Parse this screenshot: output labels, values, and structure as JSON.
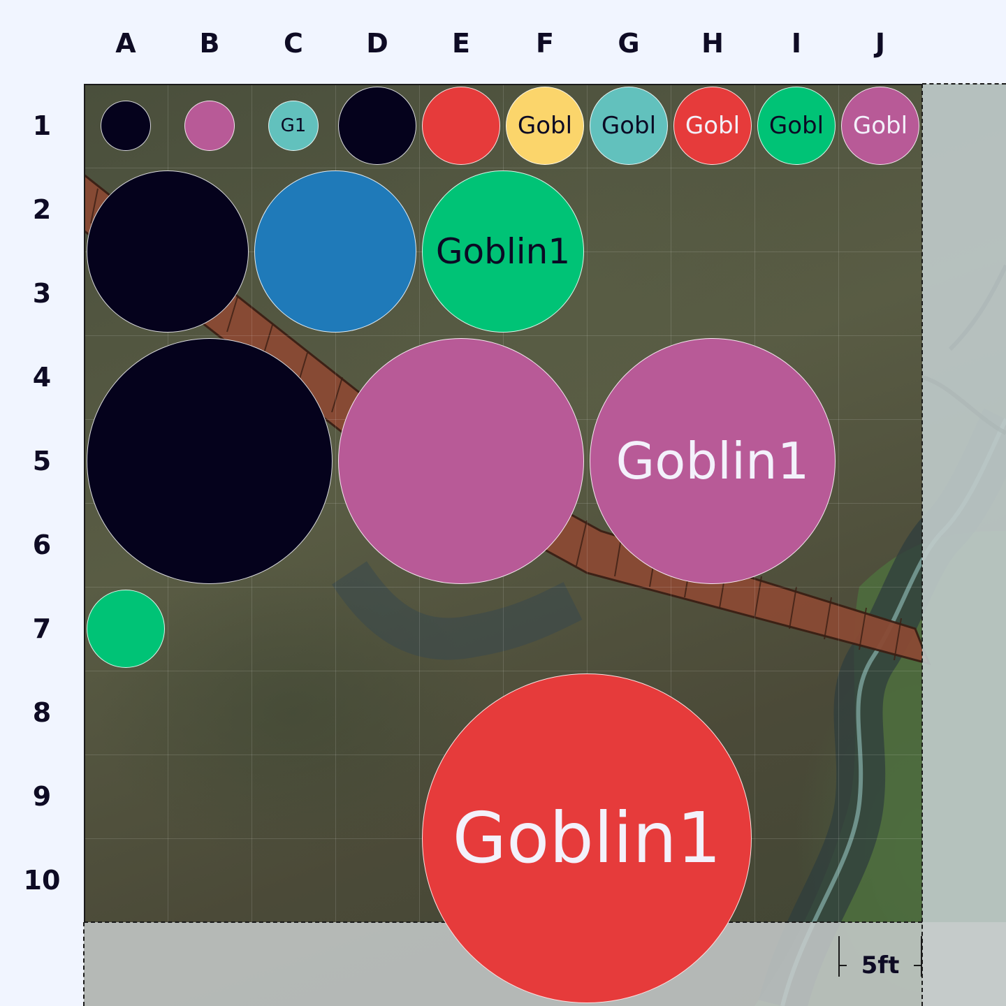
{
  "grid": {
    "columns": [
      "A",
      "B",
      "C",
      "D",
      "E",
      "F",
      "G",
      "H",
      "I",
      "J"
    ],
    "rows": [
      "1",
      "2",
      "3",
      "4",
      "5",
      "6",
      "7",
      "8",
      "9",
      "10"
    ]
  },
  "colors": {
    "navy": "#05021c",
    "pink": "#b85a97",
    "teal": "#62c1bd",
    "red": "#e63b3b",
    "yellow": "#fbd56b",
    "green": "#00c376",
    "blue": "#1f7ab9",
    "dark_text": "#0b0a24",
    "light_text": "#f3f1fb"
  },
  "tokens": [
    {
      "name": "token-a1",
      "col": 1,
      "row": 1,
      "span": 1,
      "scale": 0.6,
      "color": "#05021c",
      "label": "",
      "label_color": "#f3f1fb"
    },
    {
      "name": "token-b1",
      "col": 2,
      "row": 1,
      "span": 1,
      "scale": 0.6,
      "color": "#b85a97",
      "label": "",
      "label_color": "#f3f1fb"
    },
    {
      "name": "token-c1",
      "col": 3,
      "row": 1,
      "span": 1,
      "scale": 0.6,
      "color": "#62c1bd",
      "label": "G1",
      "label_color": "#0b0a24"
    },
    {
      "name": "token-d1",
      "col": 4,
      "row": 1,
      "span": 1,
      "scale": 0.94,
      "color": "#05021c",
      "label": "",
      "label_color": "#f3f1fb"
    },
    {
      "name": "token-e1",
      "col": 5,
      "row": 1,
      "span": 1,
      "scale": 0.94,
      "color": "#e63b3b",
      "label": "",
      "label_color": "#f3f1fb"
    },
    {
      "name": "token-f1",
      "col": 6,
      "row": 1,
      "span": 1,
      "scale": 0.94,
      "color": "#fbd56b",
      "label": "Gobl",
      "label_color": "#0b0a24"
    },
    {
      "name": "token-g1",
      "col": 7,
      "row": 1,
      "span": 1,
      "scale": 0.94,
      "color": "#62c1bd",
      "label": "Gobl",
      "label_color": "#0b0a24"
    },
    {
      "name": "token-h1",
      "col": 8,
      "row": 1,
      "span": 1,
      "scale": 0.94,
      "color": "#e63b3b",
      "label": "Gobl",
      "label_color": "#f3f1fb"
    },
    {
      "name": "token-i1",
      "col": 9,
      "row": 1,
      "span": 1,
      "scale": 0.94,
      "color": "#00c376",
      "label": "Gobl",
      "label_color": "#0b0a24"
    },
    {
      "name": "token-j1",
      "col": 10,
      "row": 1,
      "span": 1,
      "scale": 0.94,
      "color": "#b85a97",
      "label": "Gobl",
      "label_color": "#f3f1fb"
    },
    {
      "name": "token-a2",
      "col": 1,
      "row": 2,
      "span": 2,
      "scale": 0.97,
      "color": "#05021c",
      "label": "",
      "label_color": "#f3f1fb"
    },
    {
      "name": "token-c2",
      "col": 3,
      "row": 2,
      "span": 2,
      "scale": 0.97,
      "color": "#1f7ab9",
      "label": "",
      "label_color": "#f3f1fb"
    },
    {
      "name": "token-e2",
      "col": 5,
      "row": 2,
      "span": 2,
      "scale": 0.97,
      "color": "#00c376",
      "label": "Goblin1",
      "label_color": "#0b0a24"
    },
    {
      "name": "token-a4",
      "col": 1,
      "row": 4,
      "span": 3,
      "scale": 0.98,
      "color": "#05021c",
      "label": "",
      "label_color": "#f3f1fb"
    },
    {
      "name": "token-d4",
      "col": 4,
      "row": 4,
      "span": 3,
      "scale": 0.98,
      "color": "#b85a97",
      "label": "",
      "label_color": "#f3f1fb"
    },
    {
      "name": "token-g4",
      "col": 7,
      "row": 4,
      "span": 3,
      "scale": 0.98,
      "color": "#b85a97",
      "label": "Goblin1",
      "label_color": "#f3f1fb"
    },
    {
      "name": "token-a7",
      "col": 1,
      "row": 7,
      "span": 1,
      "scale": 0.94,
      "color": "#00c376",
      "label": "",
      "label_color": "#f3f1fb"
    },
    {
      "name": "token-e8",
      "col": 5,
      "row": 8,
      "span": 4,
      "scale": 0.985,
      "color": "#e63b3b",
      "label": "Goblin1",
      "label_color": "#f3f1fb"
    }
  ],
  "scale_bar": {
    "label": "5ft"
  }
}
